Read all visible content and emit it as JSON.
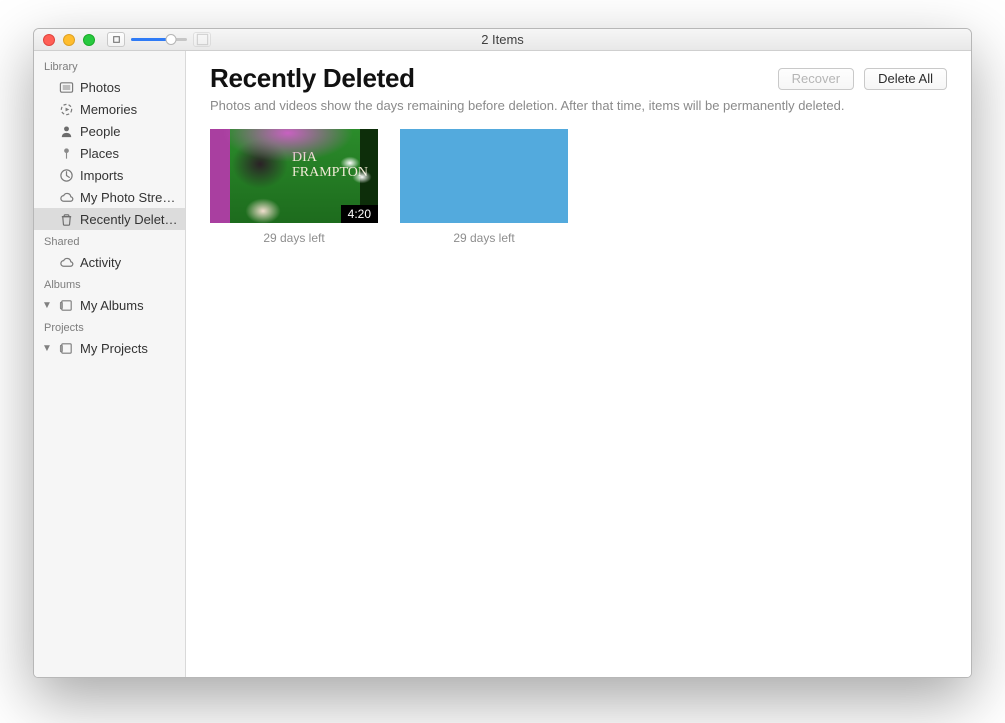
{
  "window": {
    "title": "2 Items"
  },
  "sidebar": {
    "sections": [
      {
        "header": "Library",
        "items": [
          {
            "label": "Photos",
            "icon": "photos"
          },
          {
            "label": "Memories",
            "icon": "memories"
          },
          {
            "label": "People",
            "icon": "people"
          },
          {
            "label": "Places",
            "icon": "places"
          },
          {
            "label": "Imports",
            "icon": "imports"
          },
          {
            "label": "My Photo Stre…",
            "icon": "cloud"
          },
          {
            "label": "Recently Delet…",
            "icon": "trash",
            "selected": true
          }
        ]
      },
      {
        "header": "Shared",
        "items": [
          {
            "label": "Activity",
            "icon": "cloud"
          }
        ]
      },
      {
        "header": "Albums",
        "items": [
          {
            "label": "My Albums",
            "icon": "album",
            "disclosure": true
          }
        ]
      },
      {
        "header": "Projects",
        "items": [
          {
            "label": "My Projects",
            "icon": "album",
            "disclosure": true
          }
        ]
      }
    ]
  },
  "main": {
    "title": "Recently Deleted",
    "subtitle": "Photos and videos show the days remaining before deletion. After that time, items will be permanently deleted.",
    "buttons": {
      "recover": "Recover",
      "deleteAll": "Delete All"
    },
    "items": [
      {
        "kind": "video",
        "overlayLine1": "DIA",
        "overlayLine2": "FRAMPTON",
        "duration": "4:20",
        "caption": "29 days left"
      },
      {
        "kind": "image",
        "caption": "29 days left"
      }
    ]
  }
}
